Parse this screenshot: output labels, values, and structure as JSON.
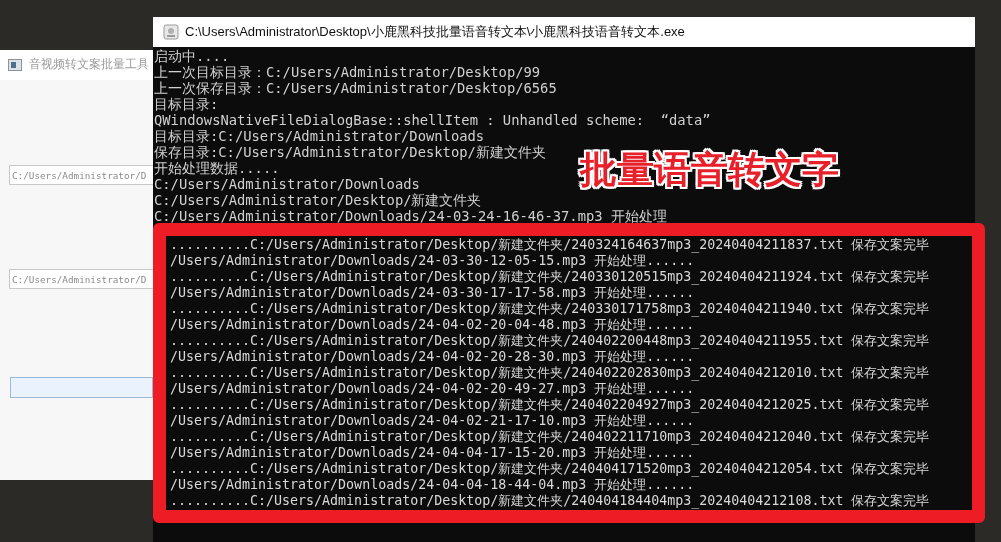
{
  "app_window": {
    "title": "音视频转文案批量工具",
    "fields": [
      {
        "value": "C:/Users/Administrator/D"
      },
      {
        "value": "C:/Users/Administrator/D"
      }
    ]
  },
  "console_window": {
    "title": "C:\\Users\\Administrator\\Desktop\\小鹿黑科技批量语音转文本\\小鹿黑科技语音转文本.exe",
    "lines": [
      "启动中....",
      "上一次目标目录：C:/Users/Administrator/Desktop/99",
      "上一次保存目录：C:/Users/Administrator/Desktop/6565",
      "目标目录:",
      "QWindowsNativeFileDialogBase::shellItem : Unhandled scheme:  “data”",
      "目标目录:C:/Users/Administrator/Downloads",
      "保存目录:C:/Users/Administrator/Desktop/新建文件夹",
      "开始处理数据.....",
      "C:/Users/Administrator/Downloads",
      "C:/Users/Administrator/Desktop/新建文件夹",
      "C:/Users/Administrator/Downloads/24-03-24-16-46-37.mp3 开始处理"
    ]
  },
  "overlay": {
    "caption": "批量语音转文字",
    "zoomed_lines": [
      "..........C:/Users/Administrator/Desktop/新建文件夹/240324164637mp3_20240404211837.txt 保存文案完毕",
      "/Users/Administrator/Downloads/24-03-30-12-05-15.mp3 开始处理......",
      "..........C:/Users/Administrator/Desktop/新建文件夹/240330120515mp3_20240404211924.txt 保存文案完毕",
      "/Users/Administrator/Downloads/24-03-30-17-17-58.mp3 开始处理......",
      "..........C:/Users/Administrator/Desktop/新建文件夹/240330171758mp3_20240404211940.txt 保存文案完毕",
      "/Users/Administrator/Downloads/24-04-02-20-04-48.mp3 开始处理......",
      "..........C:/Users/Administrator/Desktop/新建文件夹/240402200448mp3_20240404211955.txt 保存文案完毕",
      "/Users/Administrator/Downloads/24-04-02-20-28-30.mp3 开始处理......",
      "..........C:/Users/Administrator/Desktop/新建文件夹/240402202830mp3_20240404212010.txt 保存文案完毕",
      "/Users/Administrator/Downloads/24-04-02-20-49-27.mp3 开始处理......",
      "..........C:/Users/Administrator/Desktop/新建文件夹/240402204927mp3_20240404212025.txt 保存文案完毕",
      "/Users/Administrator/Downloads/24-04-02-21-17-10.mp3 开始处理......",
      "..........C:/Users/Administrator/Desktop/新建文件夹/240402211710mp3_20240404212040.txt 保存文案完毕",
      "/Users/Administrator/Downloads/24-04-04-17-15-20.mp3 开始处理......",
      "..........C:/Users/Administrator/Desktop/新建文件夹/240404171520mp3_20240404212054.txt 保存文案完毕",
      "/Users/Administrator/Downloads/24-04-04-18-44-04.mp3 开始处理......",
      "..........C:/Users/Administrator/Desktop/新建文件夹/240404184404mp3_20240404212108.txt 保存文案完毕"
    ]
  }
}
